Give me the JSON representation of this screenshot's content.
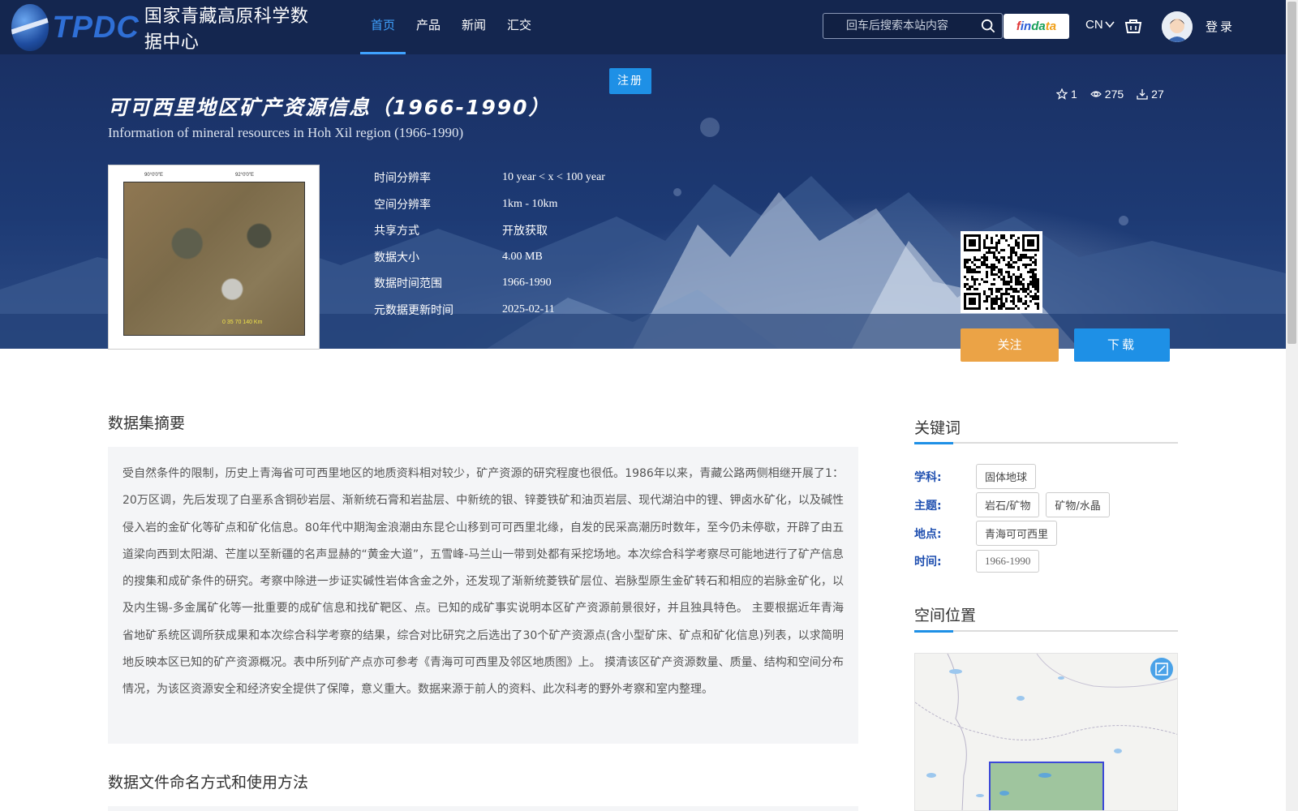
{
  "header": {
    "logo_text": "TPDC",
    "logo_cn": "国家青藏高原科学数据中心",
    "nav": [
      {
        "label": "首页",
        "active": true
      },
      {
        "label": "产品",
        "active": false
      },
      {
        "label": "新闻",
        "active": false
      },
      {
        "label": "汇交",
        "active": false
      }
    ],
    "search_placeholder": "回车后搜索本站内容",
    "findata": [
      "f",
      "in",
      "da",
      "ta"
    ],
    "lang": "CN",
    "login": "登录"
  },
  "register_label": "注册",
  "dataset": {
    "title_cn": "可可西里地区矿产资源信息（1966-1990）",
    "title_en": "Information of mineral resources in Hoh Xil region (1966-1990)",
    "stats": {
      "stars": "1",
      "views": "275",
      "downloads": "27"
    },
    "meta": [
      {
        "label": "时间分辨率",
        "value": "10 year < x < 100 year"
      },
      {
        "label": "空间分辨率",
        "value": "1km - 10km"
      },
      {
        "label": "共享方式",
        "value": "开放获取"
      },
      {
        "label": "数据大小",
        "value": "4.00 MB"
      },
      {
        "label": "数据时间范围",
        "value": "1966-1990"
      },
      {
        "label": "元数据更新时间",
        "value": "2025-02-11"
      }
    ],
    "thumbnail_ticks": {
      "top_left": "90°0′0″E",
      "top_right": "92°0′0″E",
      "scale": "0 35 70 140 Km"
    }
  },
  "buttons": {
    "follow": "关注",
    "download": "下载"
  },
  "abstract": {
    "heading": "数据集摘要",
    "text": "受自然条件的限制，历史上青海省可可西里地区的地质资料相对较少，矿产资源的研究程度也很低。1986年以来，青藏公路两侧相继开展了1：20万区调，先后发现了白垩系含铜砂岩层、渐新统石膏和岩盐层、中新统的银、锌菱铁矿和油页岩层、现代湖泊中的锂、钾卤水矿化，以及碱性侵入岩的金矿化等矿点和矿化信息。80年代中期淘金浪潮由东昆仑山移到可可西里北缘，自发的民采高潮历时数年，至今仍未停歇，开辟了由五道梁向西到太阳湖、芒崖以至新疆的名声显赫的“黄金大道”，五雪峰-马兰山一带到处都有采挖场地。本次综合科学考察尽可能地进行了矿产信息的搜集和成矿条件的研究。考察中除进一步证实碱性岩体含金之外，还发现了渐新统菱铁矿层位、岩脉型原生金矿转石和相应的岩脉金矿化，以及内生锡-多金属矿化等一批重要的成矿信息和找矿靶区、点。已知的成矿事实说明本区矿产资源前景很好，并且独具特色。 主要根据近年青海省地矿系统区调所获成果和本次综合科学考察的结果，综合对比研究之后选出了30个矿产资源点(含小型矿床、矿点和矿化信息)列表，以求简明地反映本区已知的矿产资源概况。表中所列矿产点亦可参考《青海可可西里及邻区地质图》上。 摸清该区矿产资源数量、质量、结构和空间分布情况，为该区资源安全和经济安全提供了保障，意义重大。数据来源于前人的资料、此次科考的野外考察和室内整理。"
  },
  "naming_heading": "数据文件命名方式和使用方法",
  "keywords": {
    "heading": "关键词",
    "rows": [
      {
        "label": "学科:",
        "tags": [
          "固体地球"
        ]
      },
      {
        "label": "主题:",
        "tags": [
          "岩石/矿物",
          "矿物/水晶"
        ]
      },
      {
        "label": "地点:",
        "tags": [
          "青海可可西里"
        ]
      },
      {
        "label": "时间:",
        "tags": [
          "1966-1990"
        ]
      }
    ]
  },
  "spatial_heading": "空间位置",
  "colors": {
    "accent": "#1e90e6",
    "follow": "#eba346",
    "header_bg": "#14264f",
    "keyword_label": "#1f4fb0"
  },
  "icons": [
    "search-icon",
    "cart-icon",
    "star-icon",
    "eye-icon",
    "download-icon",
    "fullscreen-icon"
  ]
}
